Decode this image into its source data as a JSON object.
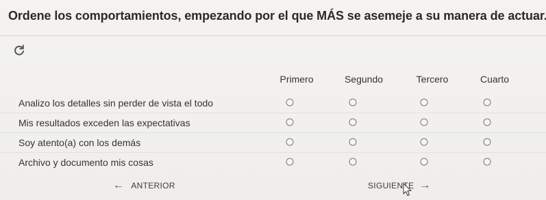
{
  "question": {
    "title": "Ordene los comportamientos, empezando por el que MÁS se asemeje a su manera de actuar."
  },
  "icons": {
    "refresh": "refresh-icon",
    "prev_arrow": "arrow-left-icon",
    "next_arrow": "arrow-right-icon",
    "cursor": "mouse-cursor-icon"
  },
  "columns": [
    "Primero",
    "Segundo",
    "Tercero",
    "Cuarto"
  ],
  "rows": [
    "Analizo los detalles sin perder de vista el todo",
    "Mis resultados exceden las expectativas",
    "Soy atento(a) con los demás",
    "Archivo y documento mis cosas"
  ],
  "navigation": {
    "prev_label": "ANTERIOR",
    "next_label": "SIGUIENTE",
    "prev_arrow": "←",
    "next_arrow": "→"
  },
  "colors": {
    "background": "#f2f1ef",
    "text": "#2b2b2b",
    "radio_border": "#777777",
    "refresh": "#555555"
  }
}
